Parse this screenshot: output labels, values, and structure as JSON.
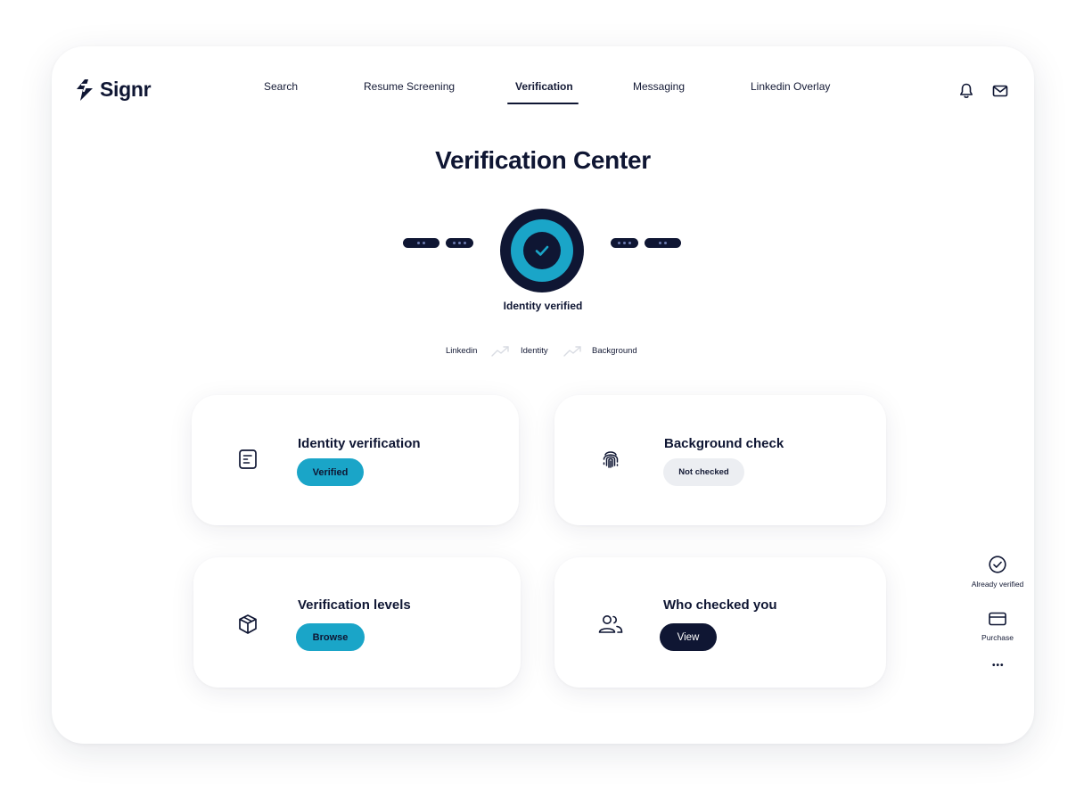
{
  "brand": {
    "name": "Signr"
  },
  "nav": {
    "items": [
      {
        "label": "Search"
      },
      {
        "label": "Resume Screening"
      },
      {
        "label": "Verification",
        "active": true
      },
      {
        "label": "Messaging"
      },
      {
        "label": "Linkedin Overlay"
      }
    ]
  },
  "header_icons": [
    "bell-icon",
    "mail-icon"
  ],
  "page": {
    "title": "Verification Center"
  },
  "status": {
    "caption": "Identity verified"
  },
  "steps": [
    "Linkedin",
    "Identity",
    "Background"
  ],
  "cards": {
    "identity": {
      "title": "Identity verification",
      "button": "Verified",
      "icon": "document-icon"
    },
    "background": {
      "title": "Background check",
      "button": "Not checked",
      "icon": "fingerprint-icon"
    },
    "levels": {
      "title": "Verification levels",
      "button": "Browse",
      "icon": "box-icon"
    },
    "who": {
      "title": "Who checked you",
      "button": "View",
      "icon": "users-icon"
    }
  },
  "side_actions": {
    "already_verified": "Already verified",
    "purchase": "Purchase",
    "more": "•••"
  },
  "colors": {
    "navy": "#0f1633",
    "teal": "#1aa5c8",
    "grey": "#eceef2"
  }
}
